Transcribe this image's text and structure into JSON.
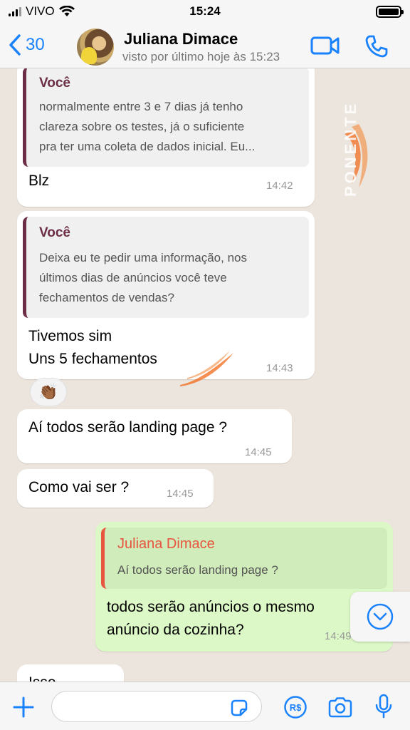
{
  "status_bar": {
    "carrier": "VIVO",
    "time": "15:24"
  },
  "header": {
    "back_count": "30",
    "contact_name": "Juliana Dimace",
    "contact_status": "visto por último hoje às 15:23"
  },
  "messages": [
    {
      "direction": "incoming",
      "quote_author": "Você",
      "quote_lines": [
        "normalmente entre 3 e 7 dias já tenho",
        "clareza sobre os testes, já o suficiente",
        "pra ter uma coleta de dados inicial. Eu..."
      ],
      "text_lines": [
        "Blz"
      ],
      "time": "14:42"
    },
    {
      "direction": "incoming",
      "quote_author": "Você",
      "quote_lines": [
        "Deixa eu te pedir uma informação, nos",
        "últimos dias de anúncios você teve",
        "fechamentos de vendas?"
      ],
      "text_lines": [
        "Tivemos sim",
        "Uns 5 fechamentos"
      ],
      "time": "14:43",
      "reaction": "👏🏾"
    },
    {
      "direction": "incoming",
      "text_lines": [
        "Aí todos serão landing page ?"
      ],
      "time": "14:45"
    },
    {
      "direction": "incoming",
      "text_lines": [
        "Como vai ser ?"
      ],
      "time": "14:45"
    },
    {
      "direction": "outgoing",
      "quote_author": "Juliana Dimace",
      "quote_lines": [
        "Aí todos serão landing page ?"
      ],
      "text_lines": [
        "todos serão anúncios o mesmo",
        "anúncio da cozinha?"
      ],
      "time": "14:49"
    },
    {
      "direction": "incoming",
      "text_lines": [
        "Isso"
      ]
    }
  ],
  "watermark_text": "PONENTE",
  "input": {
    "value": "",
    "placeholder": ""
  },
  "colors": {
    "accent": "#1982FC",
    "outgoing_bubble": "#DCF8C6",
    "quote_bar_incoming": "#6C2E46",
    "quote_bar_outgoing": "#E7553F",
    "watermark": "#F26B1D"
  }
}
